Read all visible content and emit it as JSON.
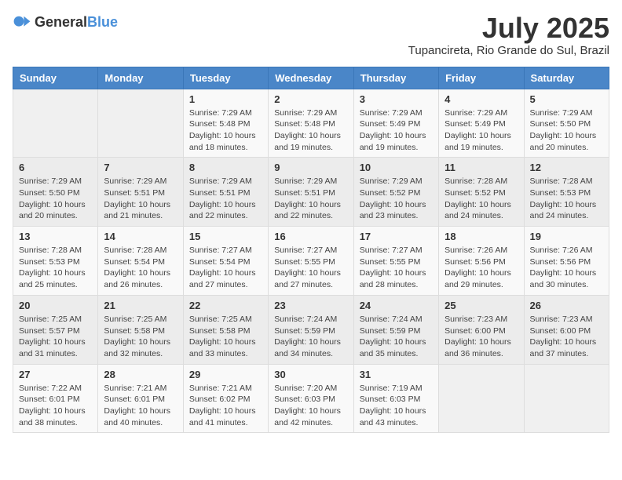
{
  "logo": {
    "general": "General",
    "blue": "Blue"
  },
  "title": {
    "month": "July 2025",
    "location": "Tupancireta, Rio Grande do Sul, Brazil"
  },
  "headers": [
    "Sunday",
    "Monday",
    "Tuesday",
    "Wednesday",
    "Thursday",
    "Friday",
    "Saturday"
  ],
  "weeks": [
    [
      {
        "day": "",
        "sunrise": "",
        "sunset": "",
        "daylight": ""
      },
      {
        "day": "",
        "sunrise": "",
        "sunset": "",
        "daylight": ""
      },
      {
        "day": "1",
        "sunrise": "Sunrise: 7:29 AM",
        "sunset": "Sunset: 5:48 PM",
        "daylight": "Daylight: 10 hours and 18 minutes."
      },
      {
        "day": "2",
        "sunrise": "Sunrise: 7:29 AM",
        "sunset": "Sunset: 5:48 PM",
        "daylight": "Daylight: 10 hours and 19 minutes."
      },
      {
        "day": "3",
        "sunrise": "Sunrise: 7:29 AM",
        "sunset": "Sunset: 5:49 PM",
        "daylight": "Daylight: 10 hours and 19 minutes."
      },
      {
        "day": "4",
        "sunrise": "Sunrise: 7:29 AM",
        "sunset": "Sunset: 5:49 PM",
        "daylight": "Daylight: 10 hours and 19 minutes."
      },
      {
        "day": "5",
        "sunrise": "Sunrise: 7:29 AM",
        "sunset": "Sunset: 5:50 PM",
        "daylight": "Daylight: 10 hours and 20 minutes."
      }
    ],
    [
      {
        "day": "6",
        "sunrise": "Sunrise: 7:29 AM",
        "sunset": "Sunset: 5:50 PM",
        "daylight": "Daylight: 10 hours and 20 minutes."
      },
      {
        "day": "7",
        "sunrise": "Sunrise: 7:29 AM",
        "sunset": "Sunset: 5:51 PM",
        "daylight": "Daylight: 10 hours and 21 minutes."
      },
      {
        "day": "8",
        "sunrise": "Sunrise: 7:29 AM",
        "sunset": "Sunset: 5:51 PM",
        "daylight": "Daylight: 10 hours and 22 minutes."
      },
      {
        "day": "9",
        "sunrise": "Sunrise: 7:29 AM",
        "sunset": "Sunset: 5:51 PM",
        "daylight": "Daylight: 10 hours and 22 minutes."
      },
      {
        "day": "10",
        "sunrise": "Sunrise: 7:29 AM",
        "sunset": "Sunset: 5:52 PM",
        "daylight": "Daylight: 10 hours and 23 minutes."
      },
      {
        "day": "11",
        "sunrise": "Sunrise: 7:28 AM",
        "sunset": "Sunset: 5:52 PM",
        "daylight": "Daylight: 10 hours and 24 minutes."
      },
      {
        "day": "12",
        "sunrise": "Sunrise: 7:28 AM",
        "sunset": "Sunset: 5:53 PM",
        "daylight": "Daylight: 10 hours and 24 minutes."
      }
    ],
    [
      {
        "day": "13",
        "sunrise": "Sunrise: 7:28 AM",
        "sunset": "Sunset: 5:53 PM",
        "daylight": "Daylight: 10 hours and 25 minutes."
      },
      {
        "day": "14",
        "sunrise": "Sunrise: 7:28 AM",
        "sunset": "Sunset: 5:54 PM",
        "daylight": "Daylight: 10 hours and 26 minutes."
      },
      {
        "day": "15",
        "sunrise": "Sunrise: 7:27 AM",
        "sunset": "Sunset: 5:54 PM",
        "daylight": "Daylight: 10 hours and 27 minutes."
      },
      {
        "day": "16",
        "sunrise": "Sunrise: 7:27 AM",
        "sunset": "Sunset: 5:55 PM",
        "daylight": "Daylight: 10 hours and 27 minutes."
      },
      {
        "day": "17",
        "sunrise": "Sunrise: 7:27 AM",
        "sunset": "Sunset: 5:55 PM",
        "daylight": "Daylight: 10 hours and 28 minutes."
      },
      {
        "day": "18",
        "sunrise": "Sunrise: 7:26 AM",
        "sunset": "Sunset: 5:56 PM",
        "daylight": "Daylight: 10 hours and 29 minutes."
      },
      {
        "day": "19",
        "sunrise": "Sunrise: 7:26 AM",
        "sunset": "Sunset: 5:56 PM",
        "daylight": "Daylight: 10 hours and 30 minutes."
      }
    ],
    [
      {
        "day": "20",
        "sunrise": "Sunrise: 7:25 AM",
        "sunset": "Sunset: 5:57 PM",
        "daylight": "Daylight: 10 hours and 31 minutes."
      },
      {
        "day": "21",
        "sunrise": "Sunrise: 7:25 AM",
        "sunset": "Sunset: 5:58 PM",
        "daylight": "Daylight: 10 hours and 32 minutes."
      },
      {
        "day": "22",
        "sunrise": "Sunrise: 7:25 AM",
        "sunset": "Sunset: 5:58 PM",
        "daylight": "Daylight: 10 hours and 33 minutes."
      },
      {
        "day": "23",
        "sunrise": "Sunrise: 7:24 AM",
        "sunset": "Sunset: 5:59 PM",
        "daylight": "Daylight: 10 hours and 34 minutes."
      },
      {
        "day": "24",
        "sunrise": "Sunrise: 7:24 AM",
        "sunset": "Sunset: 5:59 PM",
        "daylight": "Daylight: 10 hours and 35 minutes."
      },
      {
        "day": "25",
        "sunrise": "Sunrise: 7:23 AM",
        "sunset": "Sunset: 6:00 PM",
        "daylight": "Daylight: 10 hours and 36 minutes."
      },
      {
        "day": "26",
        "sunrise": "Sunrise: 7:23 AM",
        "sunset": "Sunset: 6:00 PM",
        "daylight": "Daylight: 10 hours and 37 minutes."
      }
    ],
    [
      {
        "day": "27",
        "sunrise": "Sunrise: 7:22 AM",
        "sunset": "Sunset: 6:01 PM",
        "daylight": "Daylight: 10 hours and 38 minutes."
      },
      {
        "day": "28",
        "sunrise": "Sunrise: 7:21 AM",
        "sunset": "Sunset: 6:01 PM",
        "daylight": "Daylight: 10 hours and 40 minutes."
      },
      {
        "day": "29",
        "sunrise": "Sunrise: 7:21 AM",
        "sunset": "Sunset: 6:02 PM",
        "daylight": "Daylight: 10 hours and 41 minutes."
      },
      {
        "day": "30",
        "sunrise": "Sunrise: 7:20 AM",
        "sunset": "Sunset: 6:03 PM",
        "daylight": "Daylight: 10 hours and 42 minutes."
      },
      {
        "day": "31",
        "sunrise": "Sunrise: 7:19 AM",
        "sunset": "Sunset: 6:03 PM",
        "daylight": "Daylight: 10 hours and 43 minutes."
      },
      {
        "day": "",
        "sunrise": "",
        "sunset": "",
        "daylight": ""
      },
      {
        "day": "",
        "sunrise": "",
        "sunset": "",
        "daylight": ""
      }
    ]
  ]
}
